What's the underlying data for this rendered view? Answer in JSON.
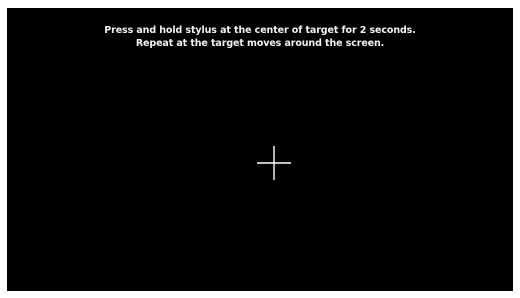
{
  "calibration": {
    "instruction_line_1": "Press and hold stylus at the center of target for 2 seconds.",
    "instruction_line_2": "Repeat at the target moves around the screen.",
    "target_icon": "crosshair-icon",
    "colors": {
      "background": "#000000",
      "text": "#f2f2f2",
      "target": "#ffffff",
      "frame": "#ffffff"
    }
  }
}
